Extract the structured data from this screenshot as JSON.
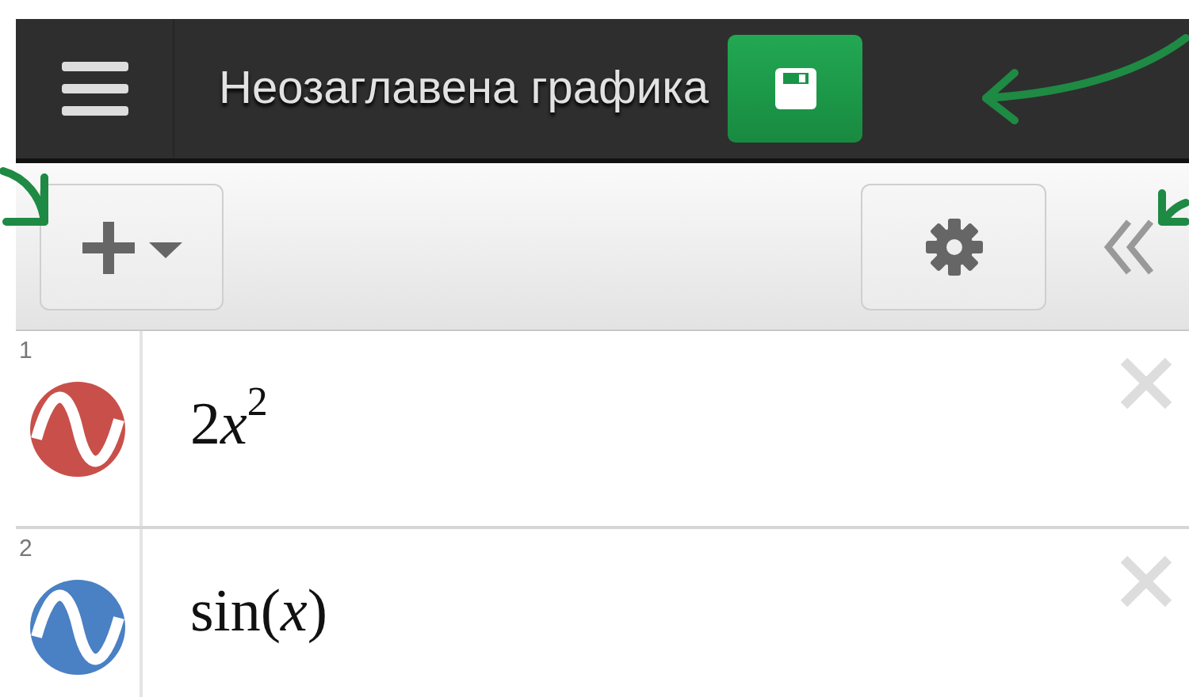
{
  "header": {
    "title": "Неозаглавена графика"
  },
  "expressions": [
    {
      "number": "1",
      "parts": [
        {
          "text": "2",
          "kind": "number"
        },
        {
          "text": "x",
          "kind": "variable"
        },
        {
          "text": "2",
          "kind": "exponent"
        }
      ],
      "color": "#c9504a"
    },
    {
      "number": "2",
      "parts": [
        {
          "text": "sin(",
          "kind": "function"
        },
        {
          "text": "x",
          "kind": "variable"
        },
        {
          "text": ")",
          "kind": "function"
        }
      ],
      "color": "#4a80c4"
    }
  ]
}
